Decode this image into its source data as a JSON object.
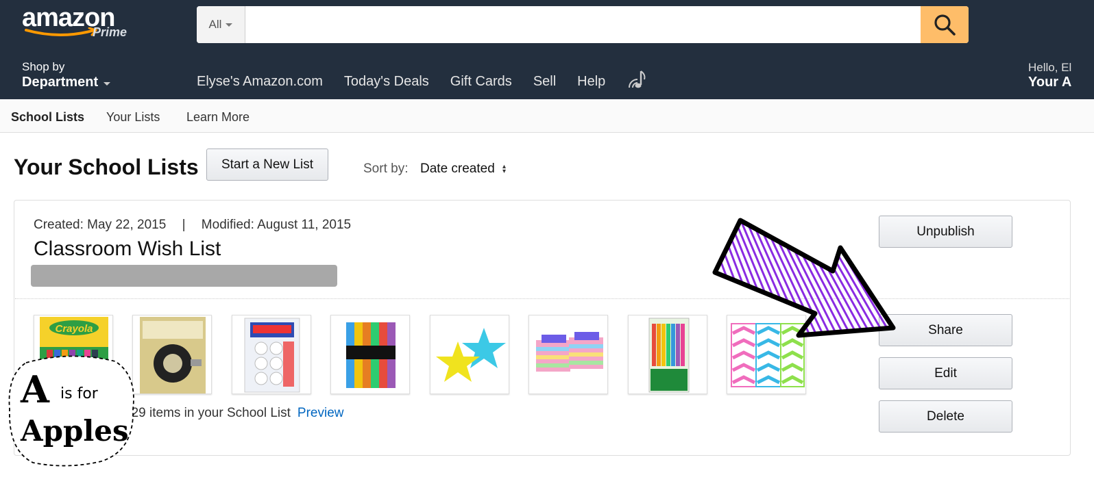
{
  "header": {
    "logo_text": "amazon",
    "logo_sub": "Prime",
    "search_scope": "All",
    "search_placeholder": "",
    "shop_by_line1": "Shop by",
    "shop_by_line2": "Department",
    "nav_links": [
      "Elyse's Amazon.com",
      "Today's Deals",
      "Gift Cards",
      "Sell",
      "Help"
    ],
    "greeting_line1": "Hello, El",
    "greeting_line2": "Your A"
  },
  "subnav": {
    "items": [
      "School Lists",
      "Your Lists",
      "Learn More"
    ]
  },
  "page": {
    "title": "Your School Lists",
    "new_list_button": "Start a New List",
    "sort_label": "Sort by:",
    "sort_value": "Date created",
    "sort_caret": "⬍"
  },
  "list_card": {
    "created": "Created: May 22, 2015",
    "separator": "|",
    "modified": "Modified: August 11, 2015",
    "name": "Classroom Wish List",
    "showing": "Showing 1 - 8 of 29 items in your School List",
    "preview_link": "Preview",
    "buttons": {
      "unpublish": "Unpublish",
      "share": "Share",
      "edit": "Edit",
      "delete": "Delete"
    },
    "products": [
      {
        "icon": "crayons-box",
        "label": "Crayola"
      },
      {
        "icon": "magnetic-tape"
      },
      {
        "icon": "magnet-dots"
      },
      {
        "icon": "construction-paper"
      },
      {
        "icon": "star-notes"
      },
      {
        "icon": "sticky-note-cubes"
      },
      {
        "icon": "gel-crayons"
      },
      {
        "icon": "chevron-tape"
      }
    ]
  },
  "overlay": {
    "badge_line1": "A",
    "badge_line1_small": "is for",
    "badge_line2": "Apples",
    "arrow_color": "#8a2be2"
  }
}
